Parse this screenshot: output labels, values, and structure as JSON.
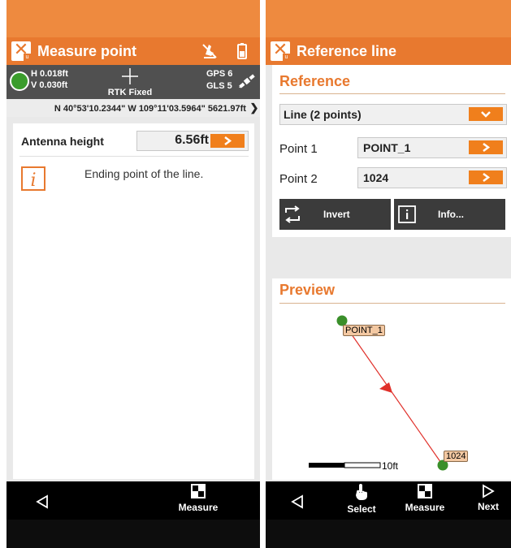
{
  "caption": {
    "left_text": "",
    "highlight_text": "",
    "right_text": ""
  },
  "colors": {
    "brand_orange": "#e8792f",
    "accent_orange": "#f07f1c",
    "fix_green": "#3a9c2c",
    "line_red": "#e0302a"
  },
  "left_screen": {
    "title": "Measure point",
    "status": {
      "h_precision": "H 0.018ft",
      "v_precision": "V 0.030ft",
      "fix": "RTK Fixed",
      "gps": "GPS 6",
      "gls": "GLS 5"
    },
    "coordinates": "N 40°53'10.2344\" W 109°11'03.5964\" 5621.97ft",
    "antenna": {
      "label": "Antenna height",
      "value": "6.56ft"
    },
    "info_message": "Ending point of the line.",
    "softkeys": {
      "measure": "Measure"
    }
  },
  "right_screen": {
    "title": "Reference line",
    "reference": {
      "heading": "Reference",
      "line_type": "Line (2 points)",
      "point1_label": "Point 1",
      "point1_value": "POINT_1",
      "point2_label": "Point 2",
      "point2_value": "1024",
      "invert_label": "Invert",
      "info_label": "Info..."
    },
    "preview": {
      "heading": "Preview",
      "start_label": "POINT_1",
      "end_label": "1024",
      "scale_label": "10ft"
    },
    "softkeys": {
      "select": "Select",
      "measure": "Measure",
      "next": "Next"
    }
  }
}
